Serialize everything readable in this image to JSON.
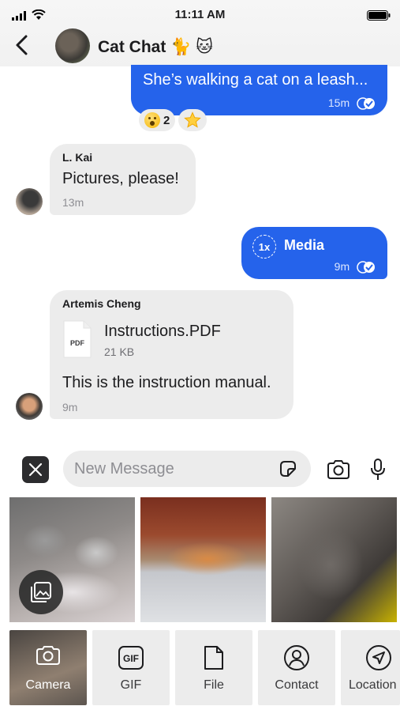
{
  "status": {
    "time": "11:11 AM"
  },
  "header": {
    "title": "Cat Chat 🐈 🐱"
  },
  "messages": [
    {
      "text": "She’s walking a cat on a leash...",
      "time": "15m"
    },
    {
      "sender": "L. Kai",
      "text": "Pictures, please!",
      "time": "13m"
    },
    {
      "speed": "1x",
      "text": "Media",
      "time": "9m"
    },
    {
      "sender": "Artemis Cheng",
      "file_name": "Instructions.PDF",
      "file_size": "21 KB",
      "file_icon": "PDF",
      "text": "This is the instruction manual.",
      "time": "9m"
    }
  ],
  "reactions": [
    {
      "emoji": "surprised-face",
      "count": "2"
    },
    {
      "emoji": "star",
      "count": ""
    }
  ],
  "composer": {
    "placeholder": "New Message"
  },
  "attachments": [
    {
      "label": "Camera"
    },
    {
      "label": "GIF"
    },
    {
      "label": "File"
    },
    {
      "label": "Contact"
    },
    {
      "label": "Location"
    }
  ],
  "colors": {
    "accent": "#2563eb",
    "bubble_in": "#ececec"
  }
}
